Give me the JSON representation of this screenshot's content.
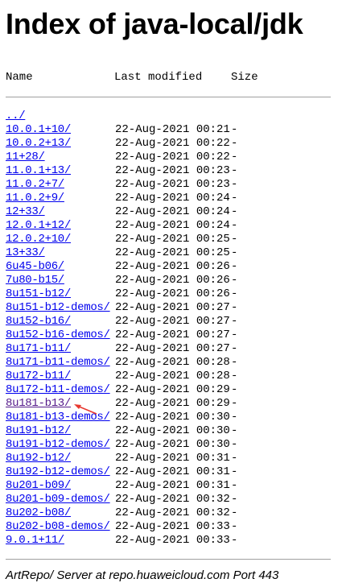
{
  "page": {
    "title": "Index of java-local/jdk",
    "columns": {
      "name": "Name",
      "modified": "Last modified",
      "size": "Size"
    },
    "parent": {
      "name": "../"
    },
    "entries": [
      {
        "name": "10.0.1+10/",
        "modified": "22-Aug-2021 00:21",
        "size": "-"
      },
      {
        "name": "10.0.2+13/",
        "modified": "22-Aug-2021 00:22",
        "size": "-"
      },
      {
        "name": "11+28/",
        "modified": "22-Aug-2021 00:22",
        "size": "-"
      },
      {
        "name": "11.0.1+13/",
        "modified": "22-Aug-2021 00:23",
        "size": "-"
      },
      {
        "name": "11.0.2+7/",
        "modified": "22-Aug-2021 00:23",
        "size": "-"
      },
      {
        "name": "11.0.2+9/",
        "modified": "22-Aug-2021 00:24",
        "size": "-"
      },
      {
        "name": "12+33/",
        "modified": "22-Aug-2021 00:24",
        "size": "-"
      },
      {
        "name": "12.0.1+12/",
        "modified": "22-Aug-2021 00:24",
        "size": "-"
      },
      {
        "name": "12.0.2+10/",
        "modified": "22-Aug-2021 00:25",
        "size": "-"
      },
      {
        "name": "13+33/",
        "modified": "22-Aug-2021 00:25",
        "size": "-"
      },
      {
        "name": "6u45-b06/",
        "modified": "22-Aug-2021 00:26",
        "size": "-"
      },
      {
        "name": "7u80-b15/",
        "modified": "22-Aug-2021 00:26",
        "size": "-"
      },
      {
        "name": "8u151-b12/",
        "modified": "22-Aug-2021 00:26",
        "size": "-"
      },
      {
        "name": "8u151-b12-demos/",
        "modified": "22-Aug-2021 00:27",
        "size": "-"
      },
      {
        "name": "8u152-b16/",
        "modified": "22-Aug-2021 00:27",
        "size": "-"
      },
      {
        "name": "8u152-b16-demos/",
        "modified": "22-Aug-2021 00:27",
        "size": "-"
      },
      {
        "name": "8u171-b11/",
        "modified": "22-Aug-2021 00:27",
        "size": "-"
      },
      {
        "name": "8u171-b11-demos/",
        "modified": "22-Aug-2021 00:28",
        "size": "-"
      },
      {
        "name": "8u172-b11/",
        "modified": "22-Aug-2021 00:28",
        "size": "-"
      },
      {
        "name": "8u172-b11-demos/",
        "modified": "22-Aug-2021 00:29",
        "size": "-"
      },
      {
        "name": "8u181-b13/",
        "modified": "22-Aug-2021 00:29",
        "size": "-",
        "visited": true
      },
      {
        "name": "8u181-b13-demos/",
        "modified": "22-Aug-2021 00:30",
        "size": "-"
      },
      {
        "name": "8u191-b12/",
        "modified": "22-Aug-2021 00:30",
        "size": "-"
      },
      {
        "name": "8u191-b12-demos/",
        "modified": "22-Aug-2021 00:30",
        "size": "-"
      },
      {
        "name": "8u192-b12/",
        "modified": "22-Aug-2021 00:31",
        "size": "-"
      },
      {
        "name": "8u192-b12-demos/",
        "modified": "22-Aug-2021 00:31",
        "size": "-"
      },
      {
        "name": "8u201-b09/",
        "modified": "22-Aug-2021 00:31",
        "size": "-"
      },
      {
        "name": "8u201-b09-demos/",
        "modified": "22-Aug-2021 00:32",
        "size": "-"
      },
      {
        "name": "8u202-b08/",
        "modified": "22-Aug-2021 00:32",
        "size": "-"
      },
      {
        "name": "8u202-b08-demos/",
        "modified": "22-Aug-2021 00:33",
        "size": "-"
      },
      {
        "name": "9.0.1+11/",
        "modified": "22-Aug-2021 00:33",
        "size": "-"
      }
    ],
    "footer": "ArtRepo/ Server at repo.huaweicloud.com Port 443"
  },
  "colors": {
    "link": "#0000ee",
    "visited_link": "#551a8b",
    "rule": "#a0a0a0",
    "annotation_arrow": "#e8382f"
  },
  "icons": {
    "annotation": "red-arrow-icon"
  }
}
